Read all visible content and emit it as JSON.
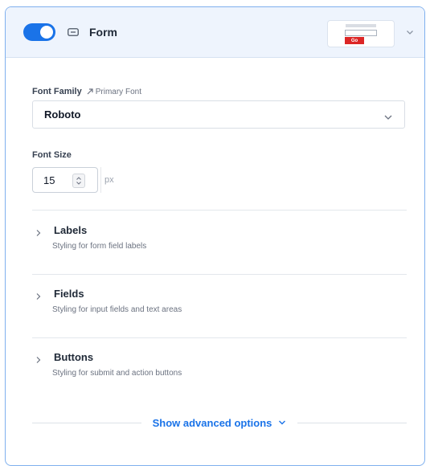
{
  "header": {
    "toggle_state": "on",
    "title": "Form",
    "preview_button_label": "Go",
    "accent_color": "#1a73e8",
    "preview_button_color": "#dc2626"
  },
  "font_family": {
    "label": "Font Family",
    "tag": "Primary Font",
    "selected": "Roboto"
  },
  "font_size": {
    "label": "Font Size",
    "value": "15",
    "unit": "px"
  },
  "sections": [
    {
      "title": "Labels",
      "description": "Styling for form field labels"
    },
    {
      "title": "Fields",
      "description": "Styling for input fields and text areas"
    },
    {
      "title": "Buttons",
      "description": "Styling for submit and action buttons"
    }
  ],
  "advanced": {
    "label": "Show advanced options"
  },
  "icons": [
    "toggle-switch",
    "form-icon",
    "chevron-down-icon",
    "link-arrow-icon",
    "stepper-icon",
    "chevron-right-icon"
  ]
}
